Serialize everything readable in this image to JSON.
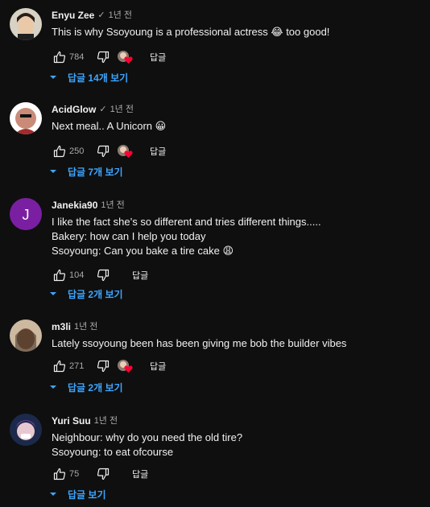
{
  "colors": {
    "background": "#0f0f0f",
    "text": "#f1f1f1",
    "secondary": "#aaaaaa",
    "link": "#3ea6ff",
    "heart": "#ff0033"
  },
  "common": {
    "reply_label": "답글",
    "verified_icon": "check-icon"
  },
  "comments": [
    {
      "author": "Enyu Zee",
      "verified": "✓",
      "time": "1년 전",
      "lines": [
        "This is why Ssoyoung is a professional actress 😂 too good!"
      ],
      "likes": "784",
      "hearted": true,
      "replies": "답글 14개 보기"
    },
    {
      "author": "AcidGlow",
      "verified": "✓",
      "time": "1년 전",
      "lines": [
        "Next meal.. A Unicorn 😀"
      ],
      "likes": "250",
      "hearted": true,
      "replies": "답글 7개 보기"
    },
    {
      "author": "Janekia90",
      "time": "1년 전",
      "avatar_letter": "J",
      "lines": [
        "I like the fact she’s so different and tries different things.....",
        "Bakery: how can I help you today",
        "Ssoyoung: Can you bake a tire cake 😩"
      ],
      "likes": "104",
      "hearted": false,
      "replies": "답글 2개 보기"
    },
    {
      "author": "m3li",
      "time": "1년 전",
      "lines": [
        "Lately ssoyoung been has been giving me bob the builder vibes"
      ],
      "likes": "271",
      "hearted": true,
      "replies": "답글 2개 보기"
    },
    {
      "author": "Yuri Suu",
      "time": "1년 전",
      "lines": [
        "Neighbour: why do you need the old tire?",
        "Ssoyoung: to eat ofcourse"
      ],
      "likes": "75",
      "hearted": false,
      "replies": "답글 보기"
    }
  ]
}
